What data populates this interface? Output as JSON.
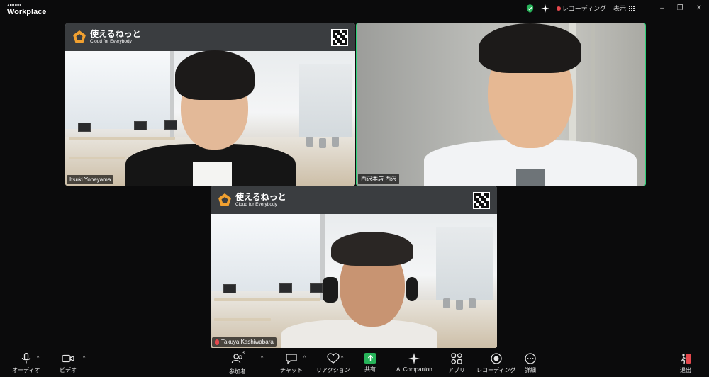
{
  "app": {
    "brand_small": "zoom",
    "brand_large": "Workplace"
  },
  "titlebar": {
    "recording_label": "レコーディング",
    "view_label": "表示"
  },
  "tiles": [
    {
      "logo_title": "使えるねっと",
      "logo_subtitle": "Cloud for Everybody",
      "participant_name": "Itsuki Yoneyama"
    },
    {
      "participant_name": "西沢本店  西沢",
      "active_speaker": true
    },
    {
      "logo_title": "使えるねっと",
      "logo_subtitle": "Cloud for Everybody",
      "participant_name": "Takuya Kashiwabara",
      "muted": true
    }
  ],
  "toolbar": {
    "audio": "オーディオ",
    "video": "ビデオ",
    "participants": "参加者",
    "participants_count": "3",
    "chat": "チャット",
    "reactions": "リアクション",
    "share": "共有",
    "ai_companion": "AI Companion",
    "apps": "アプリ",
    "recording": "レコーディング",
    "more": "詳細",
    "leave": "退出"
  },
  "colors": {
    "active_border": "#2fd17a",
    "share_green": "#27b45a",
    "record_red": "#e5484d",
    "logo_orange": "#f0a030"
  }
}
